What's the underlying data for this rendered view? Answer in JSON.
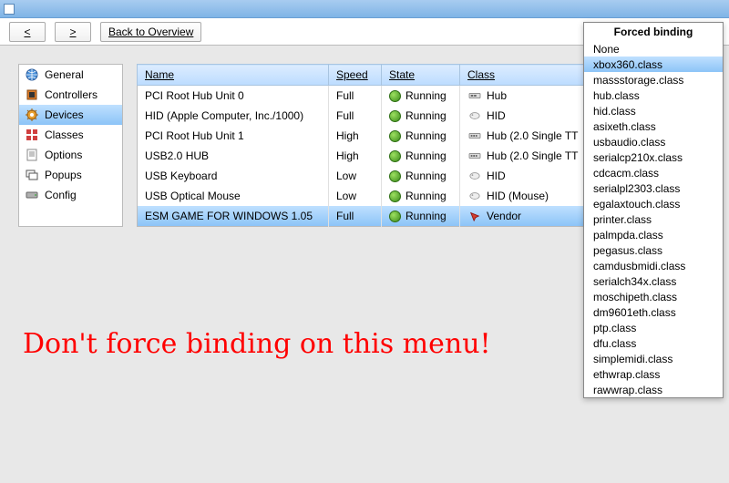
{
  "toolbar": {
    "back": "<",
    "forward": ">",
    "overview": "Back to Overview"
  },
  "sidebar": {
    "items": [
      {
        "label": "General",
        "icon": "globe"
      },
      {
        "label": "Controllers",
        "icon": "chip"
      },
      {
        "label": "Devices",
        "icon": "gear"
      },
      {
        "label": "Classes",
        "icon": "grid"
      },
      {
        "label": "Options",
        "icon": "doc"
      },
      {
        "label": "Popups",
        "icon": "popup"
      },
      {
        "label": "Config",
        "icon": "drive"
      }
    ],
    "selected": 2
  },
  "table": {
    "headers": {
      "name": "Name",
      "speed": "Speed",
      "state": "State",
      "class": "Class"
    },
    "rows": [
      {
        "name": "PCI Root Hub Unit 0",
        "speed": "Full",
        "state": "Running",
        "class": "Hub",
        "icon": "hub"
      },
      {
        "name": "HID (Apple Computer, Inc./1000)",
        "speed": "Full",
        "state": "Running",
        "class": "HID",
        "icon": "hid"
      },
      {
        "name": "PCI Root Hub Unit 1",
        "speed": "High",
        "state": "Running",
        "class": "Hub (2.0 Single TT",
        "icon": "hub2"
      },
      {
        "name": "USB2.0 HUB",
        "speed": "High",
        "state": "Running",
        "class": "Hub (2.0 Single TT",
        "icon": "hub2"
      },
      {
        "name": "USB Keyboard",
        "speed": "Low",
        "state": "Running",
        "class": "HID",
        "icon": "hid"
      },
      {
        "name": "USB Optical Mouse",
        "speed": "Low",
        "state": "Running",
        "class": "HID (Mouse)",
        "icon": "hid"
      },
      {
        "name": "ESM GAME FOR WINDOWS 1.05",
        "speed": "Full",
        "state": "Running",
        "class": "Vendor",
        "icon": "vendor"
      }
    ],
    "selected": 6
  },
  "popup": {
    "title": "Forced binding",
    "items": [
      "None",
      "xbox360.class",
      "massstorage.class",
      "hub.class",
      "hid.class",
      "asixeth.class",
      "usbaudio.class",
      "serialcp210x.class",
      "cdcacm.class",
      "serialpl2303.class",
      "egalaxtouch.class",
      "printer.class",
      "palmpda.class",
      "pegasus.class",
      "camdusbmidi.class",
      "serialch34x.class",
      "moschipeth.class",
      "dm9601eth.class",
      "ptp.class",
      "dfu.class",
      "simplemidi.class",
      "ethwrap.class",
      "rawwrap.class"
    ],
    "selected": 1
  },
  "warning": "Don't force binding on this menu!"
}
